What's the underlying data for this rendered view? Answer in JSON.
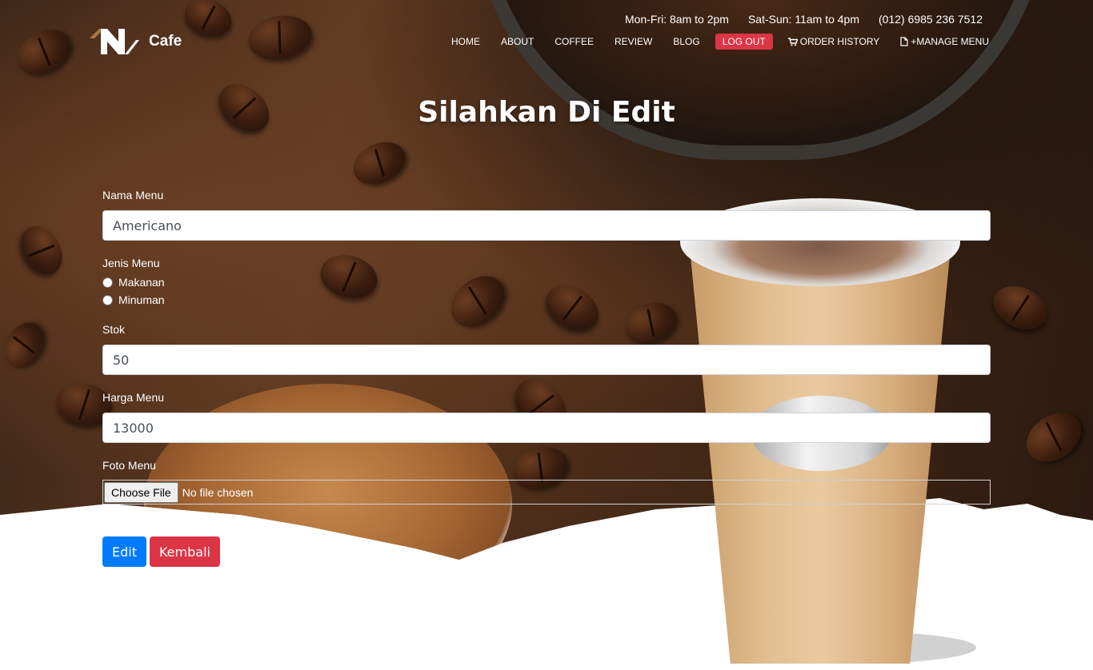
{
  "brand": {
    "name": "Cafe",
    "colors": {
      "accent_gold": "#a87a3b",
      "logout_red": "#dc3545",
      "primary_blue": "#007bff"
    }
  },
  "header": {
    "hours_weekday": "Mon-Fri: 8am to 2pm",
    "hours_weekend": "Sat-Sun: 11am to 4pm",
    "phone": "(012) 6985 236 7512",
    "nav": [
      {
        "label": "HOME"
      },
      {
        "label": "ABOUT"
      },
      {
        "label": "COFFEE"
      },
      {
        "label": "REVIEW"
      },
      {
        "label": "BLOG"
      },
      {
        "label": "LOG OUT"
      },
      {
        "label": "ORDER HISTORY",
        "icon": "cart-icon"
      },
      {
        "label": "+MANAGE MENU",
        "icon": "file-icon"
      }
    ]
  },
  "page": {
    "title": "Silahkan Di Edit"
  },
  "form": {
    "nama_label": "Nama Menu",
    "nama_value": "Americano",
    "jenis_label": "Jenis Menu",
    "jenis_options": [
      "Makanan",
      "Minuman"
    ],
    "stok_label": "Stok",
    "stok_value": "50",
    "harga_label": "Harga Menu",
    "harga_value": "13000",
    "foto_label": "Foto Menu",
    "file_button": "Choose File",
    "file_status": "No file chosen",
    "edit_button": "Edit",
    "back_button": "Kembali"
  }
}
